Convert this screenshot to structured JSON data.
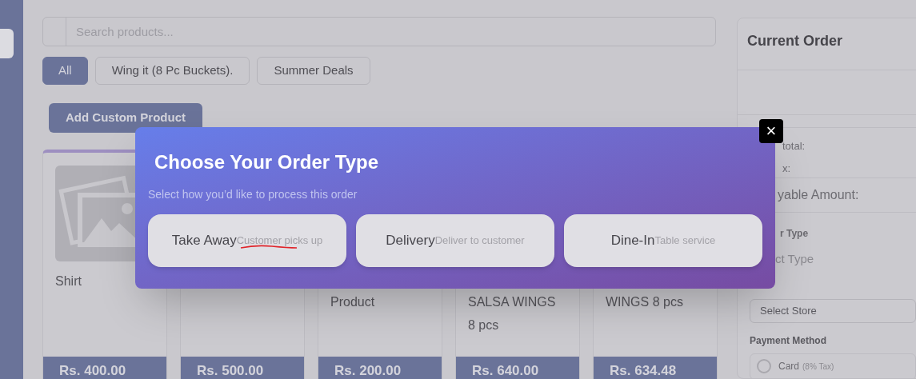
{
  "search": {
    "placeholder": "Search products..."
  },
  "categories": [
    {
      "label": "All",
      "selected": true
    },
    {
      "label": "Wing it (8 Pc Buckets).",
      "selected": false
    },
    {
      "label": "Summer Deals",
      "selected": false
    }
  ],
  "add_button": "Add Custom Product",
  "products": [
    {
      "kind": "full",
      "name": "Shirt",
      "price": "Rs. 400.00"
    },
    {
      "kind": "covered",
      "price": "Rs. 500.00"
    },
    {
      "kind": "partial",
      "name": "Product",
      "price": "Rs. 200.00"
    },
    {
      "kind": "partial",
      "name": "SALSA WINGS 8 pcs",
      "price": "Rs. 640.00"
    },
    {
      "kind": "partial",
      "name": "WINGS 8 pcs",
      "price": "Rs. 634.48"
    }
  ],
  "order_panel": {
    "title": "Current Order",
    "subtotal_label": "total:",
    "tax_label": "x:",
    "payable_label": "yable Amount:",
    "order_type_label": "r Type",
    "order_type_value": "ct Type",
    "store_select": "Select Store",
    "payment_label": "Payment Method",
    "payment_options": [
      {
        "label": "Card",
        "note": "(8% Tax)",
        "selected": false
      }
    ]
  },
  "modal": {
    "title": "Choose Your Order Type",
    "subtitle": "Select how you’d like to process this order",
    "options": [
      {
        "label": "Take Away",
        "hint": "Customer picks up",
        "annotated": true
      },
      {
        "label": "Delivery",
        "hint": "Deliver to customer",
        "annotated": false
      },
      {
        "label": "Dine-In",
        "hint": "Table service",
        "annotated": false
      }
    ],
    "close": "×"
  }
}
